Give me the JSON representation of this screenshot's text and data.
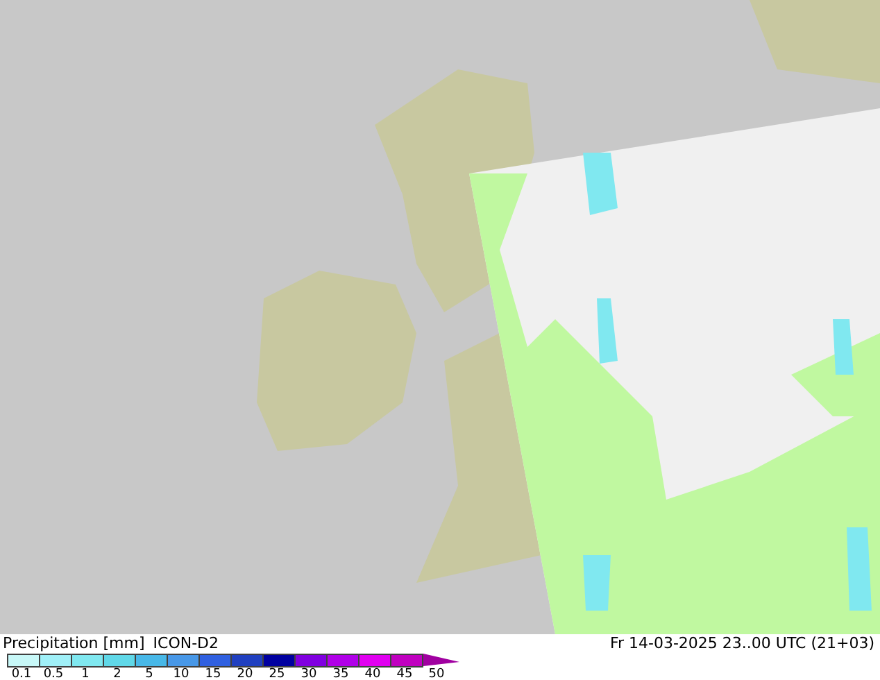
{
  "title": "Precipitation [mm]",
  "model": "ICON-D2",
  "valid_time": "Fr 14-03-2025 23..00 UTC (21+03)",
  "legend": {
    "bins": [
      {
        "color": "#c8f8f8"
      },
      {
        "color": "#a0f0f8"
      },
      {
        "color": "#80e8f0"
      },
      {
        "color": "#60d8e8"
      },
      {
        "color": "#48b8e8"
      },
      {
        "color": "#4898e8"
      },
      {
        "color": "#3060e0"
      },
      {
        "color": "#2040c0"
      },
      {
        "color": "#0000a0"
      },
      {
        "color": "#8000e0"
      },
      {
        "color": "#b000e8"
      },
      {
        "color": "#e000f0"
      },
      {
        "color": "#c000c0"
      }
    ],
    "overflow": {
      "kind": "arrow",
      "color": "#a000a0"
    },
    "labels": [
      "0.1",
      "0.5",
      "1",
      "2",
      "5",
      "10",
      "15",
      "20",
      "25",
      "30",
      "35",
      "40",
      "45",
      "50"
    ]
  }
}
